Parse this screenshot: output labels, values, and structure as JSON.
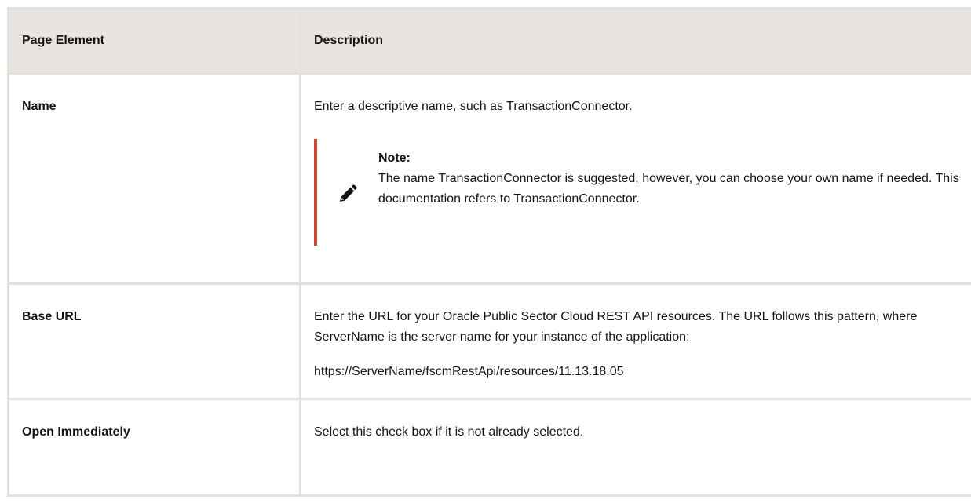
{
  "table": {
    "headers": [
      "Page Element",
      "Description"
    ],
    "rows": [
      {
        "element": "Name",
        "description": "Enter a descriptive name, such as TransactionConnector.",
        "note": {
          "title": "Note:",
          "text": "The name TransactionConnector is suggested, however, you can choose your own name if needed. This documentation refers to TransactionConnector.",
          "icon": "pencil-icon"
        }
      },
      {
        "element": "Base URL",
        "description": "Enter the URL for your Oracle Public Sector Cloud REST API resources. The URL follows this pattern, where ServerName is the server name for your instance of the application:",
        "example": "https://ServerName/fscmRestApi/resources/11.13.18.05"
      },
      {
        "element": "Open Immediately",
        "description": "Select this check box if it is not already selected."
      }
    ]
  },
  "colors": {
    "header_bg": "#e8e5e0",
    "border": "#e4e1dc",
    "note_accent": "#c74634",
    "text": "#161513"
  }
}
